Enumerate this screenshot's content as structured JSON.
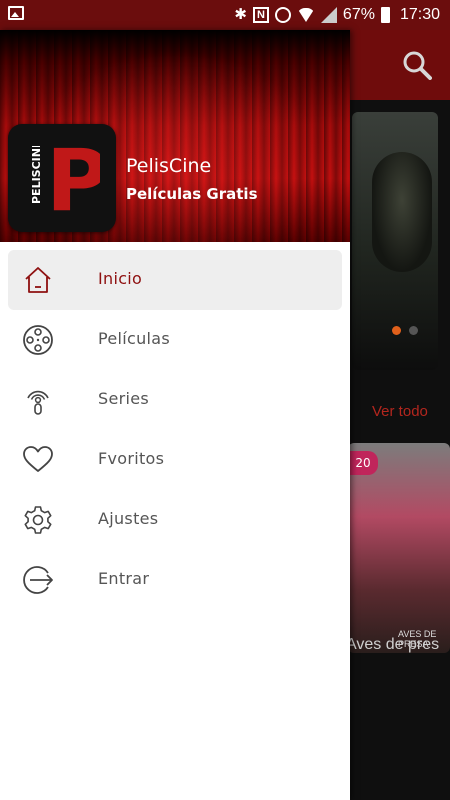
{
  "status_bar": {
    "battery": "67%",
    "time": "17:30",
    "icons": [
      "image-icon",
      "bluetooth-icon",
      "nfc-icon",
      "alarm-icon",
      "wifi-icon",
      "signal-icon",
      "battery-icon"
    ]
  },
  "colors": {
    "toolbar": "#6f0c0c",
    "accent": "#8e1010",
    "ver_todo": "#b3261e",
    "active_item_bg": "#eeeeee"
  },
  "background_app": {
    "ver_todo": "Ver todo",
    "poster_badge": "20",
    "poster_title": "Aves de pres",
    "poster_overlay_text": "AVES DE PRESA"
  },
  "drawer": {
    "app_name": "PelisCine",
    "subtitle": "Películas Gratis",
    "logo_vertical_text": "PELISCINE",
    "logo_letter": "P",
    "items": [
      {
        "label": "Inicio",
        "icon": "home-icon",
        "active": true
      },
      {
        "label": "Películas",
        "icon": "film-reel-icon",
        "active": false
      },
      {
        "label": "Series",
        "icon": "podcast-icon",
        "active": false
      },
      {
        "label": "Fvoritos",
        "icon": "heart-icon",
        "active": false
      },
      {
        "label": "Ajustes",
        "icon": "gear-icon",
        "active": false
      },
      {
        "label": "Entrar",
        "icon": "login-icon",
        "active": false
      }
    ]
  }
}
